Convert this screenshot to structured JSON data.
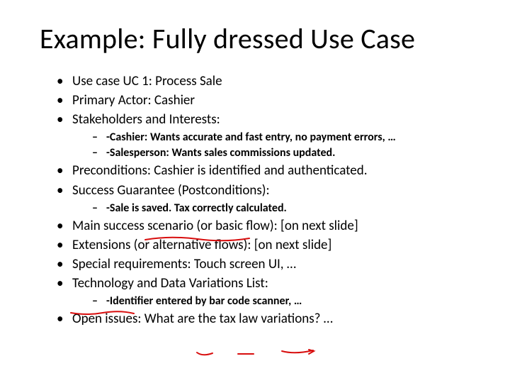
{
  "title": "Example: Fully dressed Use Case",
  "items": {
    "i0": "Use case UC 1: Process Sale",
    "i1": "Primary Actor: Cashier",
    "i2": "Stakeholders and Interests:",
    "i2s": {
      "s0": "-Cashier: Wants accurate and fast entry, no payment errors, …",
      "s1": "-Salesperson: Wants sales commissions updated."
    },
    "i3": "Preconditions: Cashier is identified and authenticated.",
    "i4": "Success Guarantee (Postconditions):",
    "i4s": {
      "s0": "-Sale is saved. Tax correctly calculated."
    },
    "i5": "Main success scenario (or basic flow): [on next slide]",
    "i6": "Extensions (or alternative flows): [on next slide]",
    "i7": "Special requirements: Touch screen UI, …",
    "i8": "Technology and Data Variations List:",
    "i8s": {
      "s0": "-Identifier entered by bar code scanner, …"
    },
    "i9": "Open issues: What are the tax law variations? …"
  },
  "annotations": {
    "stroke": "#d80e0e"
  }
}
